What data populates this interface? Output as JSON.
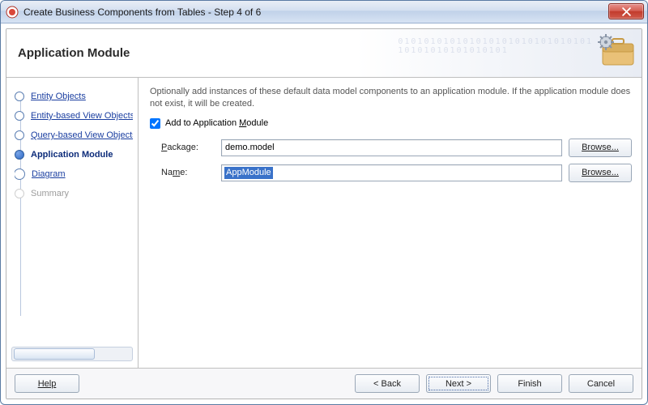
{
  "window": {
    "title": "Create Business Components from Tables - Step 4 of 6",
    "close_icon": "close-icon"
  },
  "banner": {
    "heading": "Application Module",
    "digits_pattern": "010101010101010101010101010101",
    "digits_pattern2": "10101010101010101"
  },
  "steps": [
    {
      "label": "Entity Objects",
      "state": "visited"
    },
    {
      "label": "Entity-based View Objects",
      "state": "visited"
    },
    {
      "label": "Query-based View Objects",
      "state": "visited"
    },
    {
      "label": "Application Module",
      "state": "current"
    },
    {
      "label": "Diagram",
      "state": "upcoming"
    },
    {
      "label": "Summary",
      "state": "disabled"
    }
  ],
  "content": {
    "description": "Optionally add instances of these default data model components to an application module.  If the application module does not exist, it will be created.",
    "checkbox": {
      "checked": true,
      "label_prefix": "Add to Application ",
      "mnemonic": "M",
      "label_suffix": "odule"
    },
    "fields": {
      "package": {
        "label_prefix": "P",
        "label_rest": "ackage:",
        "value": "demo.model",
        "browse": "Browse..."
      },
      "name": {
        "label_prefix": "Na",
        "mnemonic": "m",
        "label_suffix": "e:",
        "value": "AppModule",
        "browse": "Browse..."
      }
    }
  },
  "footer": {
    "help": "Help",
    "back": "< Back",
    "next": "Next >",
    "finish": "Finish",
    "cancel": "Cancel"
  }
}
